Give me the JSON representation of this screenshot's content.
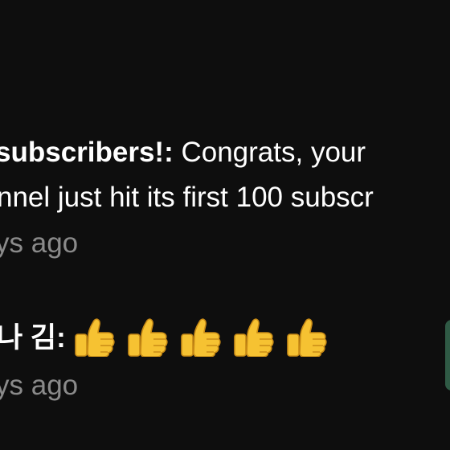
{
  "notifications": [
    {
      "title": "subscribers!:",
      "message_part1": " Congrats, your",
      "message_part2": "nnel just hit its first 100 subscr",
      "time": "ys ago"
    },
    {
      "author": "나 김:",
      "emoji_icons": [
        "thumbs-up-icon",
        "thumbs-up-icon",
        "thumbs-up-icon",
        "thumbs-up-icon",
        "thumbs-up-icon"
      ],
      "time": "ys ago"
    }
  ],
  "colors": {
    "background": "#0e0e0e",
    "text": "#ffffff",
    "muted": "#8a8a8a",
    "thumb_fill": "#f6c232",
    "thumb_outline": "#c98b16",
    "side_edge": "#2f5a45"
  }
}
